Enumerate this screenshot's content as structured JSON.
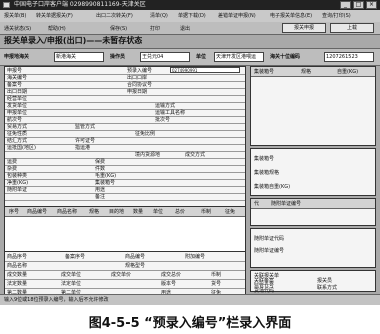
{
  "window": {
    "title": "中国电子口岸客户端 0298990811169-天津关区"
  },
  "menu": [
    "报关单(B)",
    "转关单据报关(F)",
    "出口二次转关(F)",
    "清单(Q)",
    "单据下载(D)",
    "差错单证申报(N)",
    "电子报关单信息(E)",
    "查询/打印(S)",
    "通关状态(S)",
    "帮助(H)"
  ],
  "toolbar": {
    "items": [
      "保存(S)",
      "打印",
      "退出"
    ],
    "declare_button": "报关申报",
    "upload_button": "上载"
  },
  "page_heading": "报关单录入/申报(出口)——未暂存状态",
  "info": {
    "port_label": "申报地海关",
    "port_value": "新港海关",
    "operator_label": "操作员",
    "operator_value": "王兑元04",
    "unit_label": "单位",
    "unit_value": "天津开发区港喂运",
    "code_label": "海关十位编码",
    "code_value": "1207261523"
  },
  "form": {
    "rows": [
      {
        "cols": [
          "申报号",
          "",
          "预录入编号",
          "0274990991"
        ]
      },
      {
        "cols": [
          "海关编号",
          "",
          "出口口岸",
          ""
        ]
      },
      {
        "cols": [
          "备案号",
          "",
          "合同协议号",
          ""
        ]
      },
      {
        "cols": [
          "出口日期",
          "",
          "申报日期",
          ""
        ]
      },
      {
        "cols": [
          "经营单位",
          "",
          "",
          ""
        ]
      },
      {
        "cols": [
          "发货单位",
          "",
          "运输方式",
          ""
        ]
      },
      {
        "cols": [
          "申报单位",
          "",
          "运输工具名称",
          ""
        ]
      },
      {
        "cols": [
          "航次号",
          "",
          "批次号",
          ""
        ]
      },
      {
        "cols": [
          "贸易方式",
          "",
          "监管方式",
          ""
        ]
      },
      {
        "cols": [
          "征免性质",
          "",
          "征免比例",
          ""
        ]
      },
      {
        "cols": [
          "结汇方式",
          "",
          "许可证号",
          ""
        ]
      },
      {
        "cols": [
          "运抵国(地区)",
          "",
          "指运港",
          ""
        ]
      },
      {
        "cols": [
          "境内货源地",
          "",
          "成交方式",
          ""
        ]
      },
      {
        "cols": [
          "运费",
          "",
          "保费",
          ""
        ]
      },
      {
        "cols": [
          "杂费",
          "",
          "件数",
          ""
        ]
      },
      {
        "cols": [
          "包装种类",
          "",
          "毛重(KG)",
          ""
        ]
      },
      {
        "cols": [
          "净重(KG)",
          "",
          "集装箱号",
          ""
        ]
      },
      {
        "cols": [
          "随附单证",
          "",
          "用途",
          ""
        ]
      },
      {
        "cols": [
          "备注",
          "",
          "",
          ""
        ]
      }
    ],
    "goods_headers": [
      "序号",
      "商品编号",
      "商品名称",
      "规格",
      "目的地",
      "数量",
      "单位",
      "总价",
      "币制",
      "征免"
    ],
    "bottom_rows": [
      [
        "商品序号",
        "备案序号",
        "商品编号",
        "附加编号"
      ],
      [
        "商品名称",
        "规格型号",
        "",
        ""
      ],
      [
        "成交数量",
        "成交单位",
        "成交单价",
        "成交总价",
        "币制"
      ],
      [
        "法定数量",
        "法定单位",
        "版本号",
        "货号"
      ],
      [
        "第二数量",
        "第二单位",
        "用途",
        "征免"
      ]
    ]
  },
  "right": {
    "panel1": {
      "headers": [
        "集装箱号",
        "规格",
        "自重(KG)"
      ]
    },
    "panel2": {
      "labels": [
        "集装箱号",
        "集装箱规格",
        "集装箱自重(KG)"
      ]
    },
    "panel3": {
      "headers": [
        "代",
        "随附单证编号"
      ]
    },
    "panel4": {
      "labels": [
        "随附单证代码",
        "随附单证编号"
      ]
    },
    "panel5": {
      "labels": [
        "关联报关单",
        "关联备案",
        "监管仓号",
        "货场代码"
      ]
    },
    "panel6": {
      "labels": [
        "报关员",
        "联系方式"
      ]
    }
  },
  "status": "输入9位或18位预录入编号，输入后不允许修改",
  "caption": "图4-5-5  “预录入编号”栏录入界面"
}
